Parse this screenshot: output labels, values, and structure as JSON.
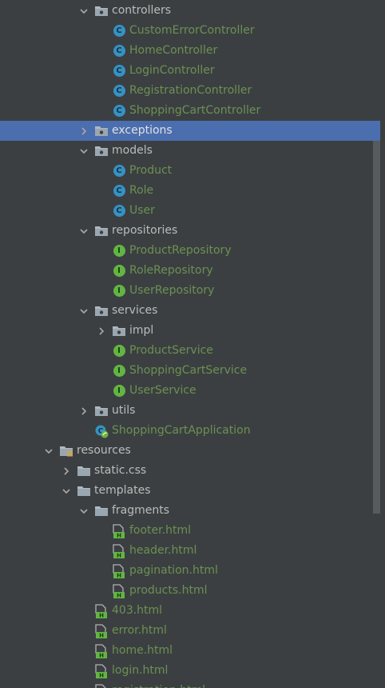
{
  "colors": {
    "background": "#3c3f41",
    "selection": "#4b6eaf",
    "dir_text": "#bbbbbb",
    "file_text": "#6a9153",
    "class_icon": "#3592c4",
    "interface_icon": "#62b543",
    "html_icon": "#62b543"
  },
  "tree": [
    {
      "label": "controllers",
      "level": 2,
      "type": "folder",
      "chevron": "down",
      "text": "dir"
    },
    {
      "label": "CustomErrorController",
      "level": 3,
      "type": "class",
      "text": "src"
    },
    {
      "label": "HomeController",
      "level": 3,
      "type": "class",
      "text": "src"
    },
    {
      "label": "LoginController",
      "level": 3,
      "type": "class",
      "text": "src"
    },
    {
      "label": "RegistrationController",
      "level": 3,
      "type": "class",
      "text": "src"
    },
    {
      "label": "ShoppingCartController",
      "level": 3,
      "type": "class",
      "text": "src"
    },
    {
      "label": "exceptions",
      "level": 2,
      "type": "folder",
      "chevron": "right",
      "text": "dir",
      "selected": true
    },
    {
      "label": "models",
      "level": 2,
      "type": "folder",
      "chevron": "down",
      "text": "dir"
    },
    {
      "label": "Product",
      "level": 3,
      "type": "class",
      "text": "src"
    },
    {
      "label": "Role",
      "level": 3,
      "type": "class",
      "text": "src"
    },
    {
      "label": "User",
      "level": 3,
      "type": "class",
      "text": "src"
    },
    {
      "label": "repositories",
      "level": 2,
      "type": "folder",
      "chevron": "down",
      "text": "dir"
    },
    {
      "label": "ProductRepository",
      "level": 3,
      "type": "interface",
      "text": "src"
    },
    {
      "label": "RoleRepository",
      "level": 3,
      "type": "interface",
      "text": "src"
    },
    {
      "label": "UserRepository",
      "level": 3,
      "type": "interface",
      "text": "src"
    },
    {
      "label": "services",
      "level": 2,
      "type": "folder",
      "chevron": "down",
      "text": "dir"
    },
    {
      "label": "impl",
      "level": 3,
      "type": "folder",
      "chevron": "right",
      "text": "dir"
    },
    {
      "label": "ProductService",
      "level": 3,
      "type": "interface",
      "text": "src"
    },
    {
      "label": "ShoppingCartService",
      "level": 3,
      "type": "interface",
      "text": "src"
    },
    {
      "label": "UserService",
      "level": 3,
      "type": "interface",
      "text": "src"
    },
    {
      "label": "utils",
      "level": 2,
      "type": "folder",
      "chevron": "right",
      "text": "dir"
    },
    {
      "label": "ShoppingCartApplication",
      "level": 2,
      "type": "spring-app",
      "text": "src"
    },
    {
      "label": "resources",
      "level": 0,
      "type": "resources-folder",
      "chevron": "down",
      "text": "dir"
    },
    {
      "label": "static.css",
      "level": 1,
      "type": "plain-folder",
      "chevron": "right",
      "text": "dir"
    },
    {
      "label": "templates",
      "level": 1,
      "type": "plain-folder",
      "chevron": "down",
      "text": "dir"
    },
    {
      "label": "fragments",
      "level": 2,
      "type": "plain-folder",
      "chevron": "down",
      "text": "dir"
    },
    {
      "label": "footer.html",
      "level": 3,
      "type": "html",
      "text": "src"
    },
    {
      "label": "header.html",
      "level": 3,
      "type": "html",
      "text": "src"
    },
    {
      "label": "pagination.html",
      "level": 3,
      "type": "html",
      "text": "src"
    },
    {
      "label": "products.html",
      "level": 3,
      "type": "html",
      "text": "src"
    },
    {
      "label": "403.html",
      "level": 2,
      "type": "html",
      "text": "src"
    },
    {
      "label": "error.html",
      "level": 2,
      "type": "html",
      "text": "src"
    },
    {
      "label": "home.html",
      "level": 2,
      "type": "html",
      "text": "src"
    },
    {
      "label": "login.html",
      "level": 2,
      "type": "html",
      "text": "src"
    },
    {
      "label": "registration.html",
      "level": 2,
      "type": "html",
      "text": "src"
    }
  ]
}
